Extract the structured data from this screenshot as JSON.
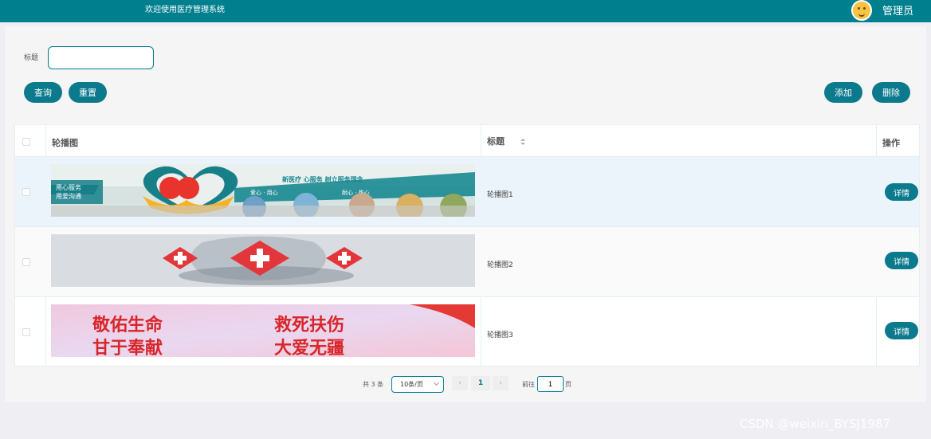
{
  "header": {
    "welcome": "欢迎使用医疗管理系统",
    "user": "管理员"
  },
  "search": {
    "title_label": "标题",
    "title_value": "",
    "query_button": "查询",
    "reset_button": "重置"
  },
  "actions": {
    "add_button": "添加",
    "delete_button": "删除"
  },
  "table": {
    "columns": [
      "轮播图",
      "标题",
      "操作"
    ],
    "rows": [
      {
        "title": "轮播图1",
        "detail": "详情",
        "image_text": [
          "新医疗 心服务 树立服务理念",
          "用心服务",
          "用爱沟通",
          "爱心 · 用心",
          "耐心 · 热心"
        ]
      },
      {
        "title": "轮播图2",
        "detail": "详情"
      },
      {
        "title": "轮播图3",
        "detail": "详情",
        "image_text": [
          "敬佑生命",
          "救死扶伤",
          "甘于奉献",
          "大爱无疆"
        ]
      }
    ]
  },
  "pagination": {
    "total": "共 3 条",
    "page_size": "10条/页",
    "current_page": "1",
    "goto_prefix": "前往",
    "goto_value": "1",
    "goto_suffix": "页"
  },
  "watermark": "CSDN @weixin_BYSJ1987",
  "colors": {
    "primary": "#007f8f",
    "button": "#0b7a8c"
  }
}
